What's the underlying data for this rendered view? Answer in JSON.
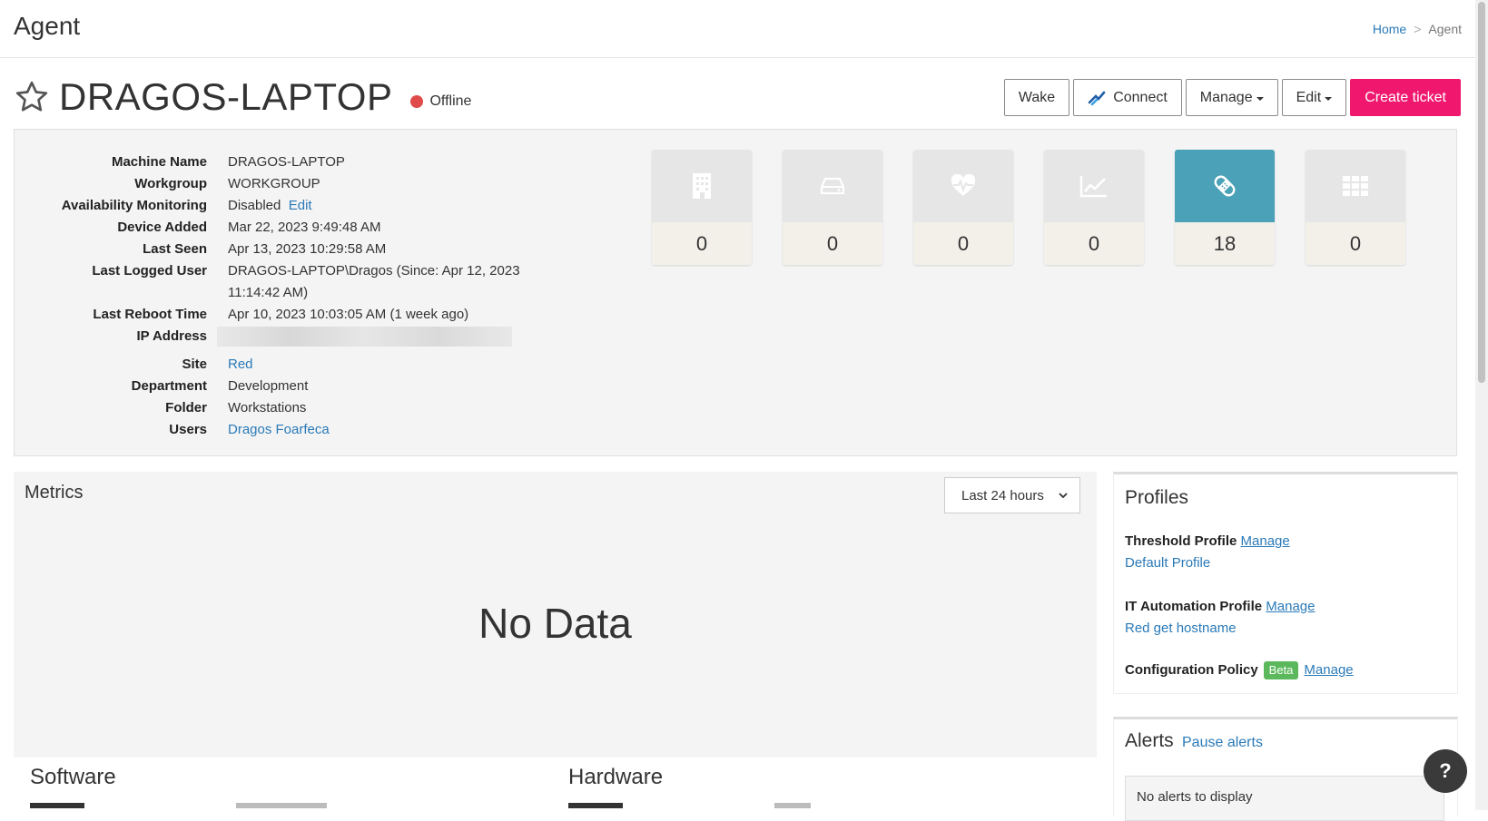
{
  "header": {
    "title": "Agent",
    "breadcrumb": [
      "Home",
      "Agent"
    ]
  },
  "device": {
    "hostname": "DRAGOS-LAPTOP",
    "status": "Offline",
    "status_color": "#e04a4a"
  },
  "actions": {
    "wake": "Wake",
    "connect": "Connect",
    "manage": "Manage",
    "edit": "Edit",
    "create_ticket": "Create ticket"
  },
  "info": {
    "rows": [
      {
        "label": "Machine Name",
        "value": "DRAGOS-LAPTOP"
      },
      {
        "label": "Workgroup",
        "value": "WORKGROUP"
      },
      {
        "label": "Availability Monitoring",
        "value": "Disabled",
        "link": "Edit"
      },
      {
        "label": "Device Added",
        "value": "Mar 22, 2023 9:49:48 AM"
      },
      {
        "label": "Last Seen",
        "value": "Apr 13, 2023 10:29:58 AM"
      },
      {
        "label": "Last Logged User",
        "value": "DRAGOS-LAPTOP\\Dragos (Since: Apr 12, 2023 11:14:42 AM)"
      },
      {
        "label": "Last Reboot Time",
        "value": "Apr 10, 2023 10:03:05 AM (1 week ago)"
      },
      {
        "label": "IP Address",
        "value": ""
      },
      {
        "label": "Site",
        "value": "Red"
      },
      {
        "label": "Department",
        "value": "Development"
      },
      {
        "label": "Folder",
        "value": "Workstations"
      },
      {
        "label": "Users",
        "value": "Dragos Foarfeca"
      }
    ]
  },
  "tiles": [
    {
      "icon": "building-icon",
      "count": "0"
    },
    {
      "icon": "drive-icon",
      "count": "0"
    },
    {
      "icon": "heart-pulse-icon",
      "count": "0"
    },
    {
      "icon": "chart-line-icon",
      "count": "0"
    },
    {
      "icon": "bandage-icon",
      "count": "18"
    },
    {
      "icon": "apps-grid-icon",
      "count": "0"
    }
  ],
  "metrics": {
    "title": "Metrics",
    "range": "Last 24 hours",
    "empty": "No Data"
  },
  "software": {
    "title": "Software"
  },
  "hardware": {
    "title": "Hardware"
  },
  "profiles": {
    "title": "Profiles",
    "threshold_label": "Threshold Profile",
    "threshold_value": "Default Profile",
    "automation_label": "IT Automation Profile",
    "automation_value": "Red get hostname",
    "config_label": "Configuration Policy",
    "beta": "Beta",
    "manage": "Manage"
  },
  "alerts": {
    "title": "Alerts",
    "pause": "Pause alerts",
    "empty": "No alerts to display"
  },
  "help": "?"
}
